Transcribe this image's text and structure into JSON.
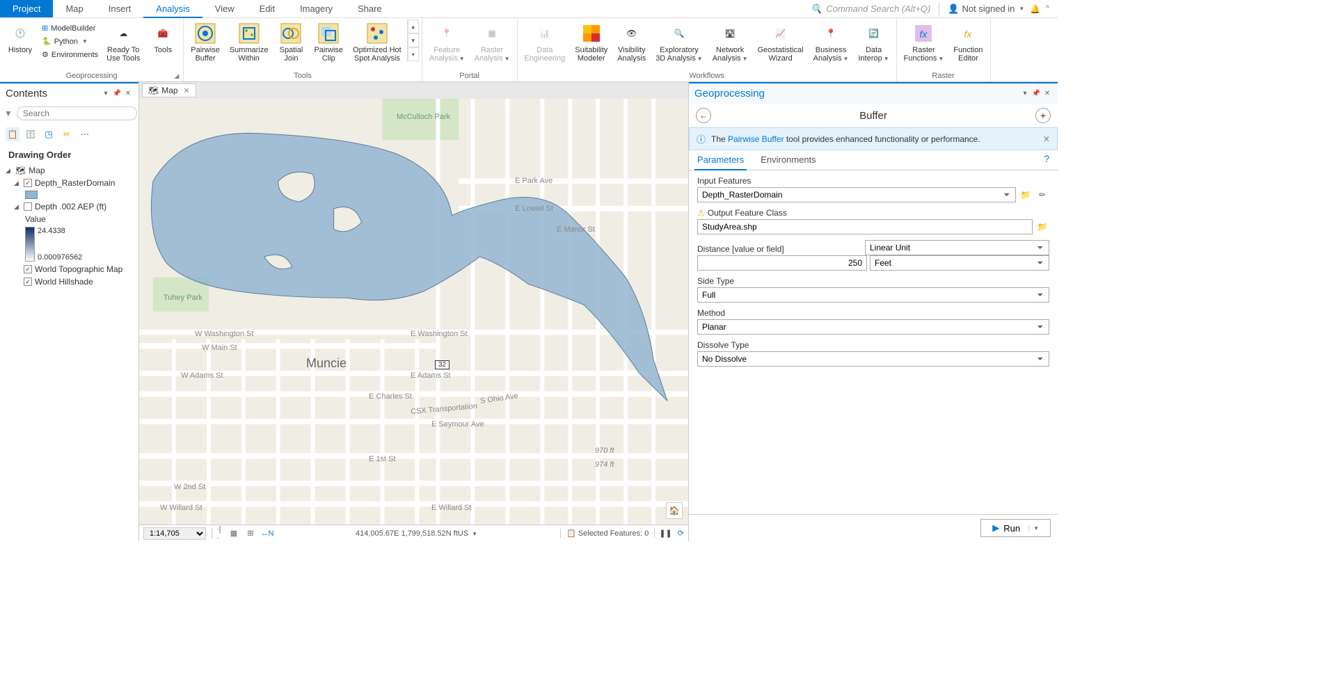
{
  "menu": {
    "tabs": [
      "Project",
      "Map",
      "Insert",
      "Analysis",
      "View",
      "Edit",
      "Imagery",
      "Share"
    ],
    "search_placeholder": "Command Search (Alt+Q)",
    "signin": "Not signed in"
  },
  "ribbon": {
    "geoprocessing": {
      "label": "Geoprocessing",
      "history": "History",
      "modelbuilder": "ModelBuilder",
      "python": "Python",
      "environments": "Environments",
      "ready": "Ready To\nUse Tools",
      "tools": "Tools"
    },
    "tools": {
      "label": "Tools",
      "pairwise_buffer": "Pairwise\nBuffer",
      "summarize_within": "Summarize\nWithin",
      "spatial_join": "Spatial\nJoin",
      "pairwise_clip": "Pairwise\nClip",
      "hotspot": "Optimized Hot\nSpot Analysis"
    },
    "portal": {
      "label": "Portal",
      "feature": "Feature\nAnalysis",
      "raster": "Raster\nAnalysis"
    },
    "workflows": {
      "label": "Workflows",
      "data_eng": "Data\nEngineering",
      "suitability": "Suitability\nModeler",
      "visibility": "Visibility\nAnalysis",
      "exploratory": "Exploratory\n3D Analysis",
      "network": "Network\nAnalysis",
      "geostat": "Geostatistical\nWizard",
      "business": "Business\nAnalysis",
      "interop": "Data\nInterop"
    },
    "raster": {
      "label": "Raster",
      "functions": "Raster\nFunctions",
      "editor": "Function\nEditor"
    }
  },
  "contents": {
    "title": "Contents",
    "search_placeholder": "Search",
    "drawing_order": "Drawing Order",
    "map": "Map",
    "layer1": "Depth_RasterDomain",
    "layer2": "Depth .002 AEP (ft)",
    "value_label": "Value",
    "value_max": "24.4338",
    "value_min": "0.000976562",
    "basemap1": "World Topographic Map",
    "basemap2": "World Hillshade"
  },
  "map": {
    "tab_name": "Map",
    "scale": "1:14,705",
    "coords": "414,005.67E 1,799,518.52N ftUS",
    "selected": "Selected Features: 0",
    "city": "Muncie",
    "streets": {
      "washington_w": "W Washington St",
      "washington_e": "E Washington St",
      "main": "W Main St",
      "adams_w": "W Adams St",
      "adams_e": "E Adams St",
      "charles": "E Charles St",
      "seymour": "E Seymour Ave",
      "first": "E 1st St",
      "second": "W 2nd St",
      "willard_w": "W Willard St",
      "willard_e": "E Willard St",
      "park": "E Park Ave",
      "lowell": "E Lowell St",
      "manor": "E Manor St",
      "ohio": "S Ohio Ave",
      "csx": "CSX Transportation",
      "elev1": "970 ft",
      "elev2": "974 ft",
      "route": "32"
    },
    "parks": {
      "mcculloch": "McCulloch Park",
      "tuhey": "Tuhey Park"
    }
  },
  "gp": {
    "title": "Geoprocessing",
    "tool": "Buffer",
    "info_pre": "The ",
    "info_link": "Pairwise Buffer",
    "info_post": " tool provides enhanced functionality or performance.",
    "tab_params": "Parameters",
    "tab_env": "Environments",
    "input_features": {
      "label": "Input Features",
      "value": "Depth_RasterDomain"
    },
    "output_fc": {
      "label": "Output Feature Class",
      "value": "StudyArea.shp"
    },
    "distance": {
      "label": "Distance [value or field]",
      "type": "Linear Unit",
      "value": "250",
      "unit": "Feet"
    },
    "side_type": {
      "label": "Side Type",
      "value": "Full"
    },
    "method": {
      "label": "Method",
      "value": "Planar"
    },
    "dissolve": {
      "label": "Dissolve Type",
      "value": "No Dissolve"
    },
    "run": "Run"
  }
}
